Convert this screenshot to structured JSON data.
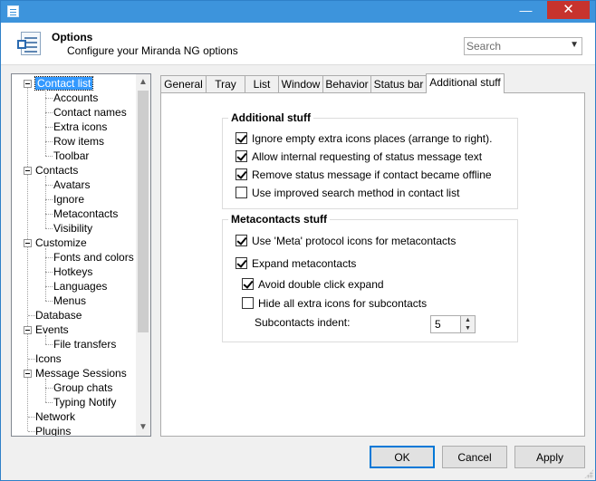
{
  "window": {
    "minimize_glyph": "—",
    "close_glyph": "✕"
  },
  "header": {
    "title": "Options",
    "subtitle": "Configure your Miranda NG options",
    "search_placeholder": "Search"
  },
  "tree": {
    "items": [
      {
        "label": "Contact list",
        "level": 0,
        "expandable": true,
        "selected": true
      },
      {
        "label": "Accounts",
        "level": 1
      },
      {
        "label": "Contact names",
        "level": 1
      },
      {
        "label": "Extra icons",
        "level": 1
      },
      {
        "label": "Row items",
        "level": 1
      },
      {
        "label": "Toolbar",
        "level": 1
      },
      {
        "label": "Contacts",
        "level": 0,
        "expandable": true
      },
      {
        "label": "Avatars",
        "level": 1
      },
      {
        "label": "Ignore",
        "level": 1
      },
      {
        "label": "Metacontacts",
        "level": 1
      },
      {
        "label": "Visibility",
        "level": 1
      },
      {
        "label": "Customize",
        "level": 0,
        "expandable": true
      },
      {
        "label": "Fonts and colors",
        "level": 1
      },
      {
        "label": "Hotkeys",
        "level": 1
      },
      {
        "label": "Languages",
        "level": 1
      },
      {
        "label": "Menus",
        "level": 1
      },
      {
        "label": "Database",
        "level": 0
      },
      {
        "label": "Events",
        "level": 0,
        "expandable": true
      },
      {
        "label": "File transfers",
        "level": 1
      },
      {
        "label": "Icons",
        "level": 0
      },
      {
        "label": "Message Sessions",
        "level": 0,
        "expandable": true
      },
      {
        "label": "Group chats",
        "level": 1
      },
      {
        "label": "Typing Notify",
        "level": 1
      },
      {
        "label": "Network",
        "level": 0
      },
      {
        "label": "Plugins",
        "level": 0
      }
    ]
  },
  "tabs": [
    "General",
    "Tray",
    "List",
    "Window",
    "Behavior",
    "Status bar",
    "Additional stuff"
  ],
  "active_tab": "Additional stuff",
  "additional": {
    "title": "Additional stuff",
    "options": [
      {
        "label": "Ignore empty extra icons places (arrange to right).",
        "checked": true
      },
      {
        "label": "Allow internal requesting of status message text",
        "checked": true
      },
      {
        "label": "Remove status message if contact became offline",
        "checked": true
      },
      {
        "label": "Use improved search method in contact list",
        "checked": false
      }
    ]
  },
  "meta": {
    "title": "Metacontacts stuff",
    "use_meta_icons": {
      "label": "Use 'Meta' protocol icons for metacontacts",
      "checked": true
    },
    "expand": {
      "label": "Expand metacontacts",
      "checked": true
    },
    "avoid_double": {
      "label": "Avoid double click expand",
      "checked": true
    },
    "hide_icons": {
      "label": "Hide all extra icons for subcontacts",
      "checked": false
    },
    "indent_label": "Subcontacts indent:",
    "indent_value": "5"
  },
  "buttons": {
    "ok": "OK",
    "cancel": "Cancel",
    "apply": "Apply"
  },
  "colors": {
    "titlebar": "#3d94dc",
    "selection": "#3399ff",
    "close": "#c7332d"
  }
}
